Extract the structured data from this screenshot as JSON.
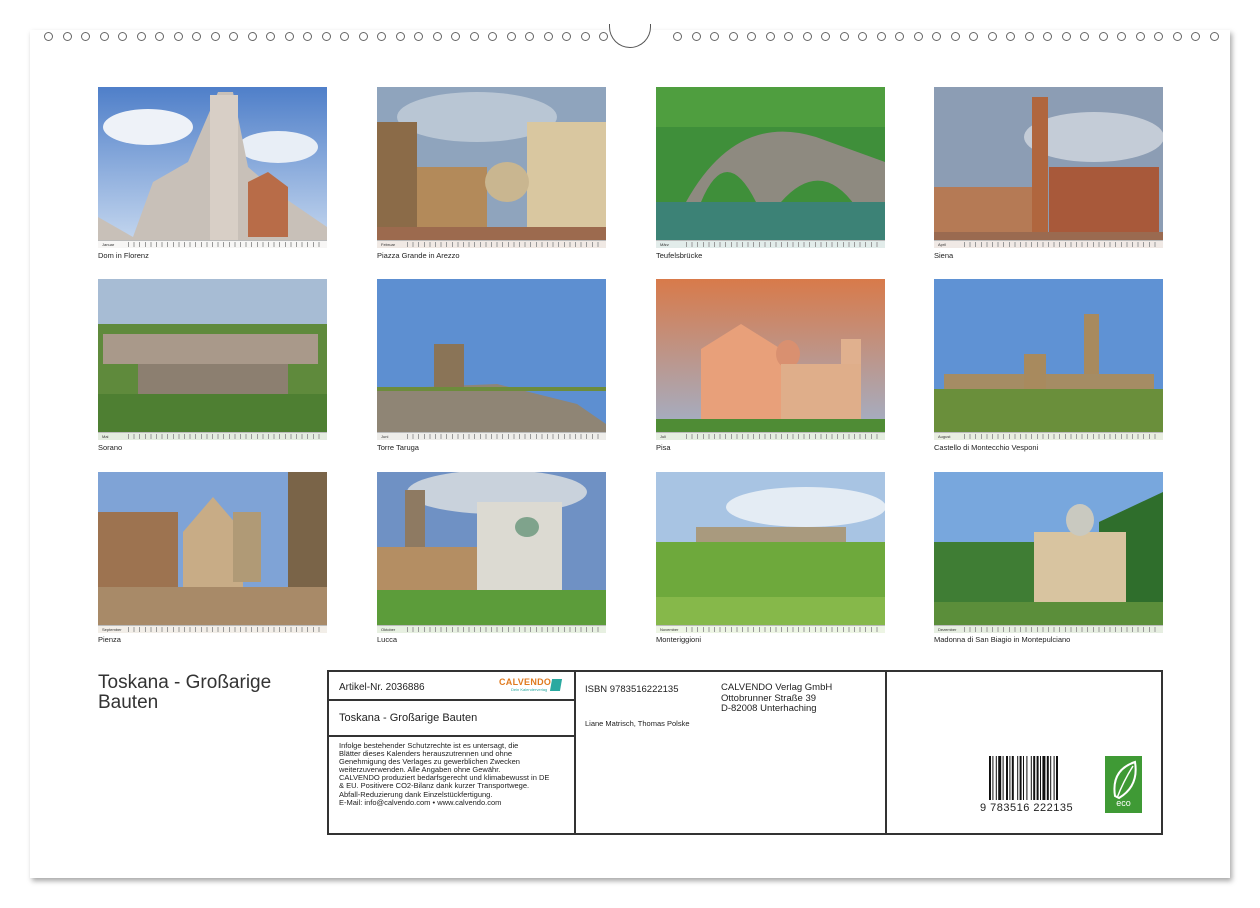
{
  "calendar": {
    "title": "Toskana - Großarige Bauten",
    "title_line1": "Toskana - Großarige",
    "title_line2": "Bauten",
    "pages": [
      {
        "month": "Januar",
        "caption": "Dom in Florenz"
      },
      {
        "month": "Februar",
        "caption": "Piazza Grande in Arezzo"
      },
      {
        "month": "März",
        "caption": "Teufelsbrücke"
      },
      {
        "month": "April",
        "caption": "Siena"
      },
      {
        "month": "Mai",
        "caption": "Sorano"
      },
      {
        "month": "Juni",
        "caption": "Torre Taruga"
      },
      {
        "month": "Juli",
        "caption": "Pisa"
      },
      {
        "month": "August",
        "caption": "Castello di Montecchio Vesponi"
      },
      {
        "month": "September",
        "caption": "Pienza"
      },
      {
        "month": "Oktober",
        "caption": "Lucca"
      },
      {
        "month": "November",
        "caption": "Monteriggioni"
      },
      {
        "month": "Dezember",
        "caption": "Madonna di San Biagio in Montepulciano"
      }
    ]
  },
  "info": {
    "article": "Artikel-Nr. 2036886",
    "product_title": "Toskana - Großarige Bauten",
    "legal_lines": [
      "Infolge bestehender Schutzrechte ist es untersagt, die",
      "Blätter dieses Kalenders herauszutrennen und ohne",
      "Genehmigung des Verlages zu gewerblichen Zwecken",
      "weiterzuverwenden. Alle Angaben ohne Gewähr.",
      "CALVENDO produziert bedarfsgerecht und klimabewusst in DE",
      "& EU. Positivere CO2-Bilanz dank kurzer Transportwege.",
      "Abfall-Reduzierung dank Einzelstückfertigung.",
      "E-Mail: info@calvendo.com • www.calvendo.com"
    ],
    "isbn": "ISBN 9783516222135",
    "authors": "Liane Matrisch, Thomas Polske",
    "publisher": "CALVENDO Verlag GmbH",
    "street": "Ottobrunner Straße 39",
    "city": "D-82008 Unterhaching",
    "barcode_digits": "9   783516   222135",
    "logo_text": "CALVENDO",
    "logo_sub": "Dein Kalenderverlag",
    "eco_label": "eco"
  },
  "colors": {
    "eco_green": "#3f9a35",
    "logo_teal": "#2aa9a0",
    "logo_orange": "#e07a1f"
  }
}
